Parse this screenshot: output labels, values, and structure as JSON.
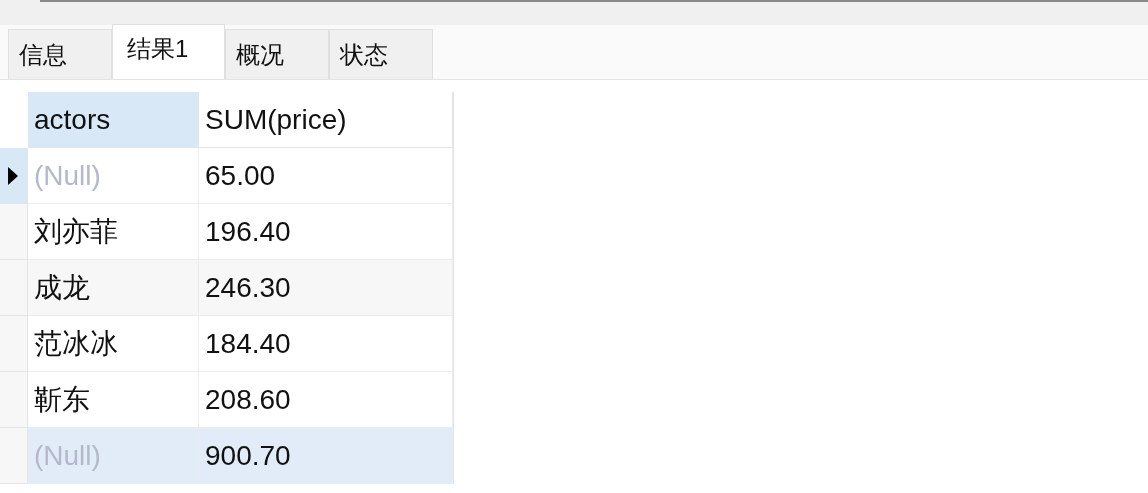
{
  "tabs": [
    {
      "label": "信息",
      "selected": false
    },
    {
      "label": "结果1",
      "selected": true
    },
    {
      "label": "概况",
      "selected": false
    },
    {
      "label": "状态",
      "selected": false
    }
  ],
  "table": {
    "columns": [
      {
        "label": "actors",
        "selected": true
      },
      {
        "label": "SUM(price)",
        "selected": false
      }
    ],
    "rows": [
      {
        "selected": true,
        "hovered": false,
        "cells": [
          {
            "text": "(Null)",
            "null": true
          },
          {
            "text": "65.00",
            "null": false
          }
        ]
      },
      {
        "selected": false,
        "hovered": false,
        "cells": [
          {
            "text": "刘亦菲",
            "null": false
          },
          {
            "text": "196.40",
            "null": false
          }
        ]
      },
      {
        "selected": false,
        "hovered": false,
        "cells": [
          {
            "text": "成龙",
            "null": false
          },
          {
            "text": "246.30",
            "null": false
          }
        ]
      },
      {
        "selected": false,
        "hovered": false,
        "cells": [
          {
            "text": "范冰冰",
            "null": false
          },
          {
            "text": "184.40",
            "null": false
          }
        ]
      },
      {
        "selected": false,
        "hovered": false,
        "cells": [
          {
            "text": "靳东",
            "null": false
          },
          {
            "text": "208.60",
            "null": false
          }
        ]
      },
      {
        "selected": false,
        "hovered": true,
        "cells": [
          {
            "text": "(Null)",
            "null": true
          },
          {
            "text": "900.70",
            "null": false
          }
        ]
      }
    ]
  }
}
